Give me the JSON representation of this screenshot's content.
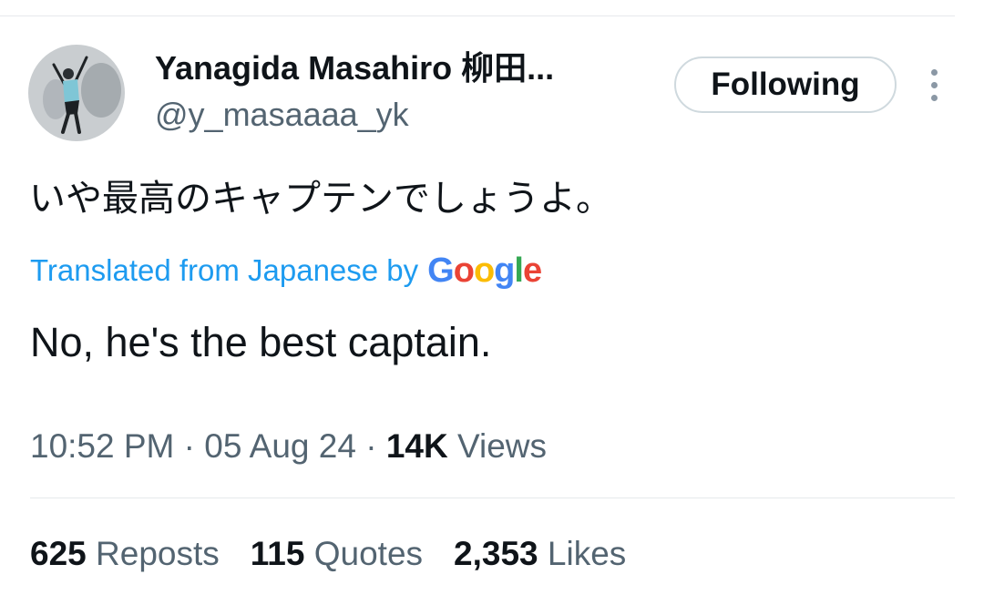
{
  "author": {
    "display_name": "Yanagida Masahiro 柳田...",
    "handle": "@y_masaaaa_yk"
  },
  "follow_button": {
    "label": "Following"
  },
  "more_icon": "vertical-ellipsis-icon",
  "tweet": {
    "original_text": "いや最高のキャプテンでしょうよ。",
    "translated_label": "Translated from Japanese by",
    "translator_logo": {
      "letters": [
        "G",
        "o",
        "o",
        "g",
        "l",
        "e"
      ],
      "colors": [
        "#4285f4",
        "#ea4335",
        "#fbbc05",
        "#4285f4",
        "#34a853",
        "#ea4335"
      ]
    },
    "translated_text": "No, he's the best captain."
  },
  "meta": {
    "time": "10:52 PM",
    "separator": "·",
    "date": "05 Aug 24",
    "views_count": "14K",
    "views_label": "Views"
  },
  "stats": {
    "reposts_count": "625",
    "reposts_label": "Reposts",
    "quotes_count": "115",
    "quotes_label": "Quotes",
    "likes_count": "2,353",
    "likes_label": "Likes"
  },
  "colors": {
    "link": "#1d9bf0",
    "secondary_text": "#536471",
    "primary_text": "#0f1419"
  }
}
